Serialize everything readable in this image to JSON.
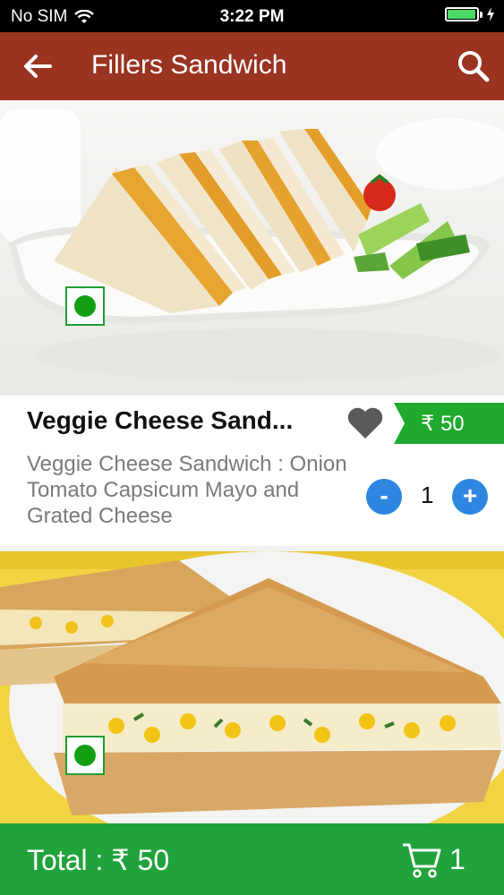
{
  "status_bar": {
    "carrier": "No SIM",
    "time": "3:22 PM"
  },
  "header": {
    "title": "Fillers Sandwich",
    "back_icon": "back-arrow-icon",
    "search_icon": "search-icon"
  },
  "products": [
    {
      "name": "Veggie Cheese Sand...",
      "description": "Veggie Cheese Sandwich : Onion Tomato Capsicum Mayo and Grated Cheese",
      "price": "₹ 50",
      "quantity": "1",
      "minus_label": "-",
      "plus_label": "+",
      "veg": true
    },
    {
      "veg": true
    }
  ],
  "footer": {
    "total": "Total : ₹ 50",
    "cart_count": "1",
    "cart_icon": "cart-icon"
  },
  "colors": {
    "header": "#9a3320",
    "footer": "#21a33c",
    "price_tag": "#1faa2e",
    "qty_buttons": "#2f86e0",
    "veg": "#12a012"
  }
}
